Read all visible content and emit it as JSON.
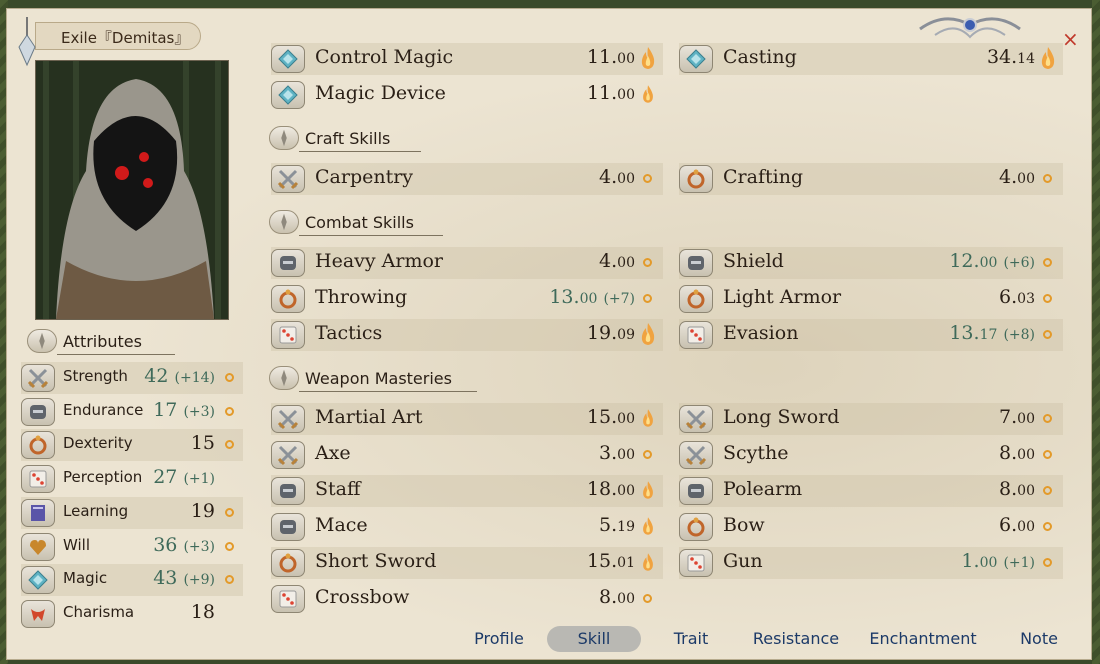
{
  "window": {
    "title": "Exile『Demitas』",
    "close_label": "×"
  },
  "attributes": {
    "header": "Attributes",
    "items": [
      {
        "name": "Strength",
        "value": "42",
        "bonus": "(+14)",
        "icon": "crossed-swords-icon",
        "ind": "ring"
      },
      {
        "name": "Endurance",
        "value": "17",
        "bonus": "(+3)",
        "icon": "helmet-icon",
        "ind": "ring"
      },
      {
        "name": "Dexterity",
        "value": "15",
        "bonus": "",
        "icon": "ring-icon",
        "ind": "ring"
      },
      {
        "name": "Perception",
        "value": "27",
        "bonus": "(+1)",
        "icon": "dice-icon",
        "ind": "none"
      },
      {
        "name": "Learning",
        "value": "19",
        "bonus": "",
        "icon": "book-icon",
        "ind": "ring"
      },
      {
        "name": "Will",
        "value": "36",
        "bonus": "(+3)",
        "icon": "heart-icon",
        "ind": "ring"
      },
      {
        "name": "Magic",
        "value": "43",
        "bonus": "(+9)",
        "icon": "crystal-icon",
        "ind": "ring"
      },
      {
        "name": "Charisma",
        "value": "18",
        "bonus": "",
        "icon": "ribbon-icon",
        "ind": "none"
      }
    ]
  },
  "magic_skills": [
    {
      "name": "Control Magic",
      "int": "11.",
      "dec": "00",
      "bonus": "",
      "icon": "crystal-icon",
      "ind": "flame"
    },
    {
      "name": "Casting",
      "int": "34.",
      "dec": "14",
      "bonus": "",
      "icon": "crystal-icon",
      "ind": "flame"
    },
    {
      "name": "Magic Device",
      "int": "11.",
      "dec": "00",
      "bonus": "",
      "icon": "crystal-icon",
      "ind": "flame-small"
    }
  ],
  "craft_section": {
    "header": "Craft Skills",
    "skills": [
      {
        "name": "Carpentry",
        "int": "4.",
        "dec": "00",
        "bonus": "",
        "icon": "crossed-swords-icon",
        "ind": "ring"
      },
      {
        "name": "Crafting",
        "int": "4.",
        "dec": "00",
        "bonus": "",
        "icon": "ring-icon",
        "ind": "ring"
      }
    ]
  },
  "combat_section": {
    "header": "Combat Skills",
    "skills": [
      {
        "name": "Heavy Armor",
        "int": "4.",
        "dec": "00",
        "bonus": "",
        "icon": "helmet-icon",
        "ind": "ring"
      },
      {
        "name": "Shield",
        "int": "12.",
        "dec": "00",
        "bonus": "(+6)",
        "icon": "helmet-icon",
        "ind": "ring"
      },
      {
        "name": "Throwing",
        "int": "13.",
        "dec": "00",
        "bonus": "(+7)",
        "icon": "ring-icon",
        "ind": "ring"
      },
      {
        "name": "Light Armor",
        "int": "6.",
        "dec": "03",
        "bonus": "",
        "icon": "ring-icon",
        "ind": "ring"
      },
      {
        "name": "Tactics",
        "int": "19.",
        "dec": "09",
        "bonus": "",
        "icon": "dice-icon",
        "ind": "flame"
      },
      {
        "name": "Evasion",
        "int": "13.",
        "dec": "17",
        "bonus": "(+8)",
        "icon": "dice-icon",
        "ind": "ring"
      }
    ]
  },
  "weapon_section": {
    "header": "Weapon Masteries",
    "skills": [
      {
        "name": "Martial Art",
        "int": "15.",
        "dec": "00",
        "bonus": "",
        "icon": "crossed-swords-icon",
        "ind": "flame-small"
      },
      {
        "name": "Long Sword",
        "int": "7.",
        "dec": "00",
        "bonus": "",
        "icon": "crossed-swords-icon",
        "ind": "ring"
      },
      {
        "name": "Axe",
        "int": "3.",
        "dec": "00",
        "bonus": "",
        "icon": "crossed-swords-icon",
        "ind": "ring"
      },
      {
        "name": "Scythe",
        "int": "8.",
        "dec": "00",
        "bonus": "",
        "icon": "crossed-swords-icon",
        "ind": "ring"
      },
      {
        "name": "Staff",
        "int": "18.",
        "dec": "00",
        "bonus": "",
        "icon": "helmet-icon",
        "ind": "flame-small"
      },
      {
        "name": "Polearm",
        "int": "8.",
        "dec": "00",
        "bonus": "",
        "icon": "helmet-icon",
        "ind": "ring"
      },
      {
        "name": "Mace",
        "int": "5.",
        "dec": "19",
        "bonus": "",
        "icon": "helmet-icon",
        "ind": "flame-small"
      },
      {
        "name": "Bow",
        "int": "6.",
        "dec": "00",
        "bonus": "",
        "icon": "ring-icon",
        "ind": "ring"
      },
      {
        "name": "Short Sword",
        "int": "15.",
        "dec": "01",
        "bonus": "",
        "icon": "ring-icon",
        "ind": "flame-small"
      },
      {
        "name": "Gun",
        "int": "1.",
        "dec": "00",
        "bonus": "(+1)",
        "icon": "dice-icon",
        "ind": "ring"
      },
      {
        "name": "Crossbow",
        "int": "8.",
        "dec": "00",
        "bonus": "",
        "icon": "dice-icon",
        "ind": "ring"
      }
    ]
  },
  "tabs": [
    {
      "label": "Profile",
      "active": false
    },
    {
      "label": "Skill",
      "active": true
    },
    {
      "label": "Trait",
      "active": false
    },
    {
      "label": "Resistance",
      "active": false
    },
    {
      "label": "Enchantment",
      "active": false
    },
    {
      "label": "Note",
      "active": false
    }
  ],
  "colors": {
    "bonus_value": "#3f6a5a",
    "indicator": "#e39a2a",
    "tab_text": "#1c3a68",
    "close": "#c0392b"
  }
}
